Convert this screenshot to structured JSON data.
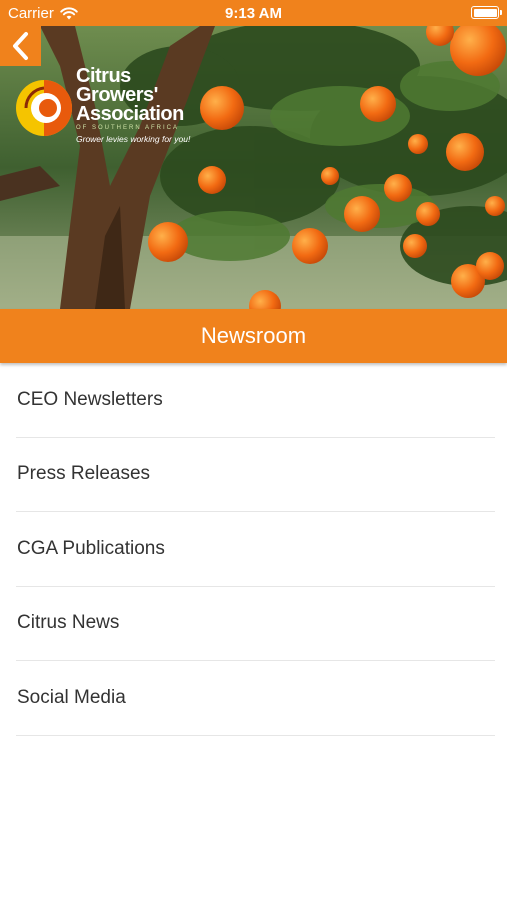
{
  "status_bar": {
    "carrier": "Carrier",
    "time": "9:13 AM",
    "icons": [
      "wifi-icon",
      "battery-icon"
    ]
  },
  "header": {
    "back_icon": "chevron-left-icon",
    "logo": {
      "line1": "Citrus",
      "line2": "Growers'",
      "line3": "Association",
      "subline": "OF SOUTHERN AFRICA",
      "tagline": "Grower levies working for you!"
    },
    "title": "Newsroom"
  },
  "menu": {
    "items": [
      {
        "label": "CEO Newsletters"
      },
      {
        "label": "Press Releases"
      },
      {
        "label": "CGA Publications"
      },
      {
        "label": "Citrus News"
      },
      {
        "label": "Social Media"
      }
    ]
  },
  "colors": {
    "accent": "#f0821c",
    "text": "#333333",
    "divider": "#e6e6e6"
  }
}
